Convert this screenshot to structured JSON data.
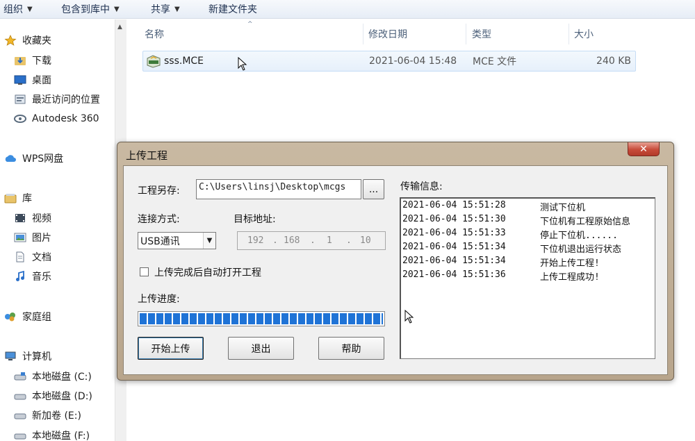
{
  "toolbar": {
    "organize": "组织",
    "include_library": "包含到库中",
    "share": "共享",
    "new_folder": "新建文件夹"
  },
  "sidebar": {
    "favorites": "收藏夹",
    "downloads": "下载",
    "desktop": "桌面",
    "recent": "最近访问的位置",
    "autodesk": "Autodesk 360",
    "wps": "WPS网盘",
    "libraries": "库",
    "videos": "视频",
    "pictures": "图片",
    "documents": "文档",
    "music": "音乐",
    "homegroup": "家庭组",
    "computer": "计算机",
    "disk_c": "本地磁盘 (C:)",
    "disk_d": "本地磁盘 (D:)",
    "disk_e": "新加卷 (E:)",
    "disk_f": "本地磁盘 (F:)"
  },
  "file_list": {
    "headers": {
      "name": "名称",
      "date": "修改日期",
      "type": "类型",
      "size": "大小"
    },
    "files": [
      {
        "name": "sss.MCE",
        "date": "2021-06-04 15:48",
        "type": "MCE 文件",
        "size": "240 KB"
      }
    ]
  },
  "dialog": {
    "title": "上传工程",
    "close_label": "✕",
    "save_as_label": "工程另存:",
    "save_path": "C:\\Users\\linsj\\Desktop\\mcgs",
    "browse_label": "...",
    "connection_label": "连接方式:",
    "connection_value": "USB通讯",
    "target_label": "目标地址:",
    "ip": [
      "192",
      "168",
      "1",
      "10"
    ],
    "auto_open_label": "上传完成后自动打开工程",
    "progress_label": "上传进度:",
    "progress": 1.0,
    "start_button": "开始上传",
    "exit_button": "退出",
    "help_button": "帮助",
    "log_label": "传输信息:",
    "log": [
      {
        "time": "2021-06-04 15:51:28",
        "message": "测试下位机"
      },
      {
        "time": "2021-06-04 15:51:30",
        "message": "下位机有工程原始信息"
      },
      {
        "time": "2021-06-04 15:51:33",
        "message": "停止下位机......"
      },
      {
        "time": "2021-06-04 15:51:34",
        "message": "下位机退出运行状态"
      },
      {
        "time": "2021-06-04 15:51:34",
        "message": "开始上传工程!"
      },
      {
        "time": "2021-06-04 15:51:36",
        "message": "上传工程成功!"
      }
    ]
  },
  "colors": {
    "progress_blue": "#1f73d6",
    "close_red": "#c74b3a"
  }
}
